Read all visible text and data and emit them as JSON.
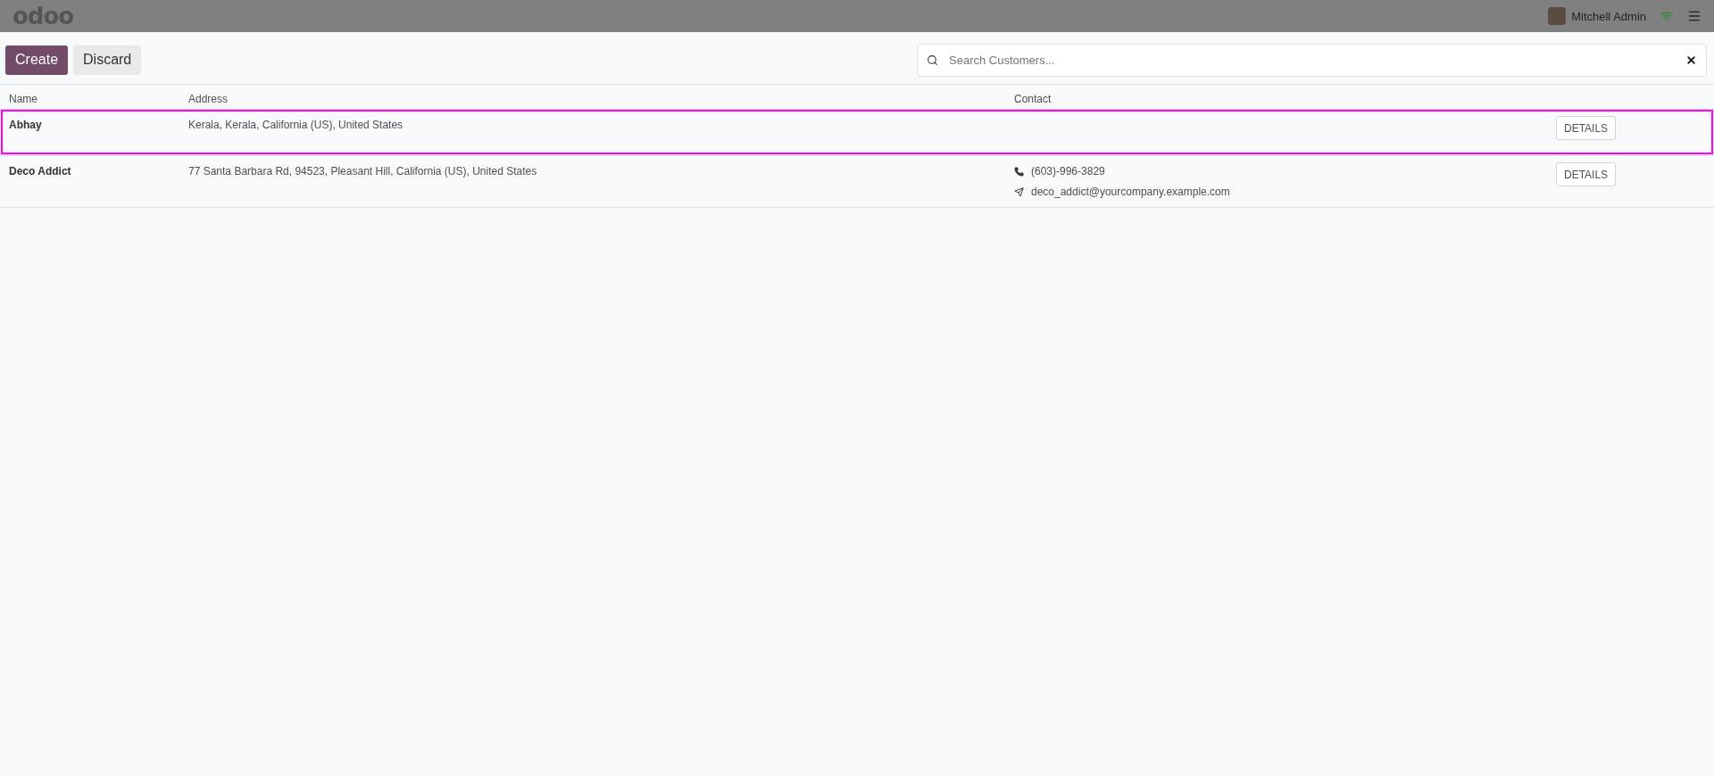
{
  "navbar": {
    "logo": "odoo",
    "user": "Mitchell Admin"
  },
  "toolbar": {
    "buttons": [
      {
        "label": "Create",
        "kind": "primary"
      },
      {
        "label": "Discard",
        "kind": "secondary"
      }
    ],
    "search": {
      "placeholder": "Search Customers..."
    }
  },
  "table": {
    "columns": [
      "Name",
      "Address",
      "Contact"
    ],
    "rows": [
      {
        "name": "Abhay",
        "address": "Kerala, Kerala, California (US), United States",
        "contacts": [],
        "action": "DETAILS",
        "selected": true
      },
      {
        "name": "Deco Addict",
        "address": "77 Santa Barbara Rd, 94523, Pleasant Hill, California (US), United States",
        "contacts": [
          {
            "kind": "phone",
            "value": "(603)-996-3829"
          },
          {
            "kind": "email",
            "value": "deco_addict@yourcompany.example.com"
          }
        ],
        "action": "DETAILS",
        "selected": false
      }
    ]
  }
}
